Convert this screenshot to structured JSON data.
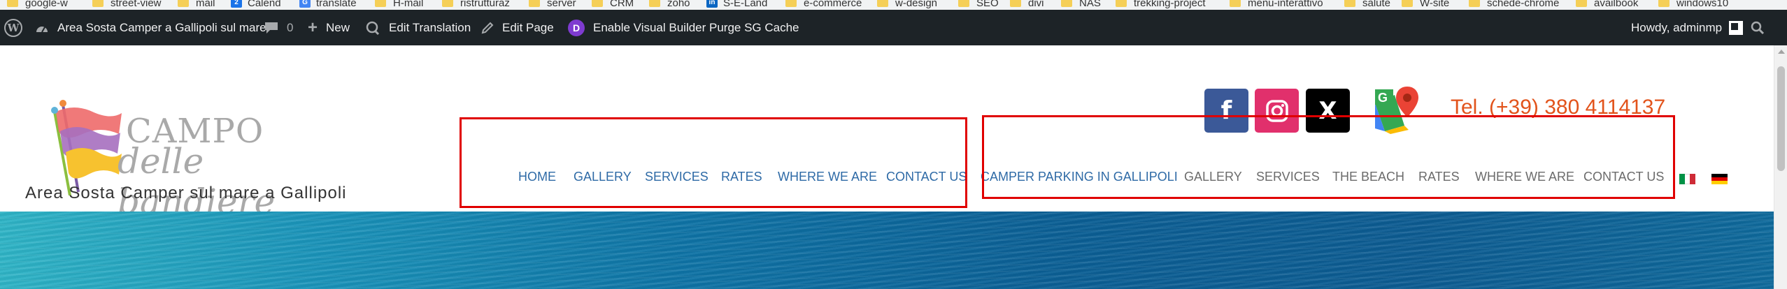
{
  "bookmarks": [
    {
      "label": "google-w",
      "icon": "folder-icon"
    },
    {
      "label": "street-view",
      "icon": "folder-icon"
    },
    {
      "label": "mail",
      "icon": "folder-icon"
    },
    {
      "label": "Calend",
      "icon": "calendar-icon"
    },
    {
      "label": "translate",
      "icon": "translate-icon"
    },
    {
      "label": "H-mail",
      "icon": "folder-icon"
    },
    {
      "label": "ristrutturaz",
      "icon": "folder-icon"
    },
    {
      "label": "server",
      "icon": "folder-icon"
    },
    {
      "label": "CRM",
      "icon": "folder-icon"
    },
    {
      "label": "zoho",
      "icon": "folder-icon"
    },
    {
      "label": "S-E-Land",
      "icon": "linkedin-icon"
    },
    {
      "label": "e-commerce",
      "icon": "folder-icon"
    },
    {
      "label": "w-design",
      "icon": "folder-icon"
    },
    {
      "label": "SEO",
      "icon": "folder-icon"
    },
    {
      "label": "divi",
      "icon": "folder-icon"
    },
    {
      "label": "NAS",
      "icon": "folder-icon"
    },
    {
      "label": "trekking-project",
      "icon": "folder-icon"
    },
    {
      "label": "menu-interattivo",
      "icon": "folder-icon"
    },
    {
      "label": "salute",
      "icon": "folder-icon"
    },
    {
      "label": "W-site",
      "icon": "folder-icon"
    },
    {
      "label": "schede-chrome",
      "icon": "folder-icon"
    },
    {
      "label": "availbook",
      "icon": "folder-icon"
    },
    {
      "label": "windows10",
      "icon": "folder-icon"
    }
  ],
  "adminbar": {
    "site_name": "Area Sosta Camper a Gallipoli sul mare",
    "comments_count": "0",
    "new_label": "New",
    "edit_translation": "Edit Translation",
    "edit_page": "Edit Page",
    "visual_builder": "Enable Visual Builder",
    "purge_cache": "Purge SG Cache",
    "howdy": "Howdy, adminmp",
    "divi_letter": "D"
  },
  "logo": {
    "line1": "CAMPO",
    "line2": "delle bandiere",
    "tagline": "Area Sosta Camper sul mare a Gallipoli"
  },
  "contact": {
    "phone": "Tel. (+39) 380 4114137",
    "facebook_glyph": "f",
    "x_glyph": "X"
  },
  "menu_primary": [
    "HOME",
    "GALLERY",
    "SERVICES",
    "RATES",
    "WHERE WE ARE",
    "CONTACT US"
  ],
  "menu_secondary_active": "CAMPER PARKING IN GALLIPOLI",
  "menu_secondary": [
    "GALLERY",
    "SERVICES",
    "THE BEACH",
    "RATES",
    "WHERE WE ARE",
    "CONTACT US"
  ],
  "colors": {
    "menu_blue": "#2e6aa6",
    "menu_grey": "#6b6b6b",
    "phone_orange": "#e2531b",
    "highlight_red": "#e00000",
    "adminbar_bg": "#1d2327"
  }
}
